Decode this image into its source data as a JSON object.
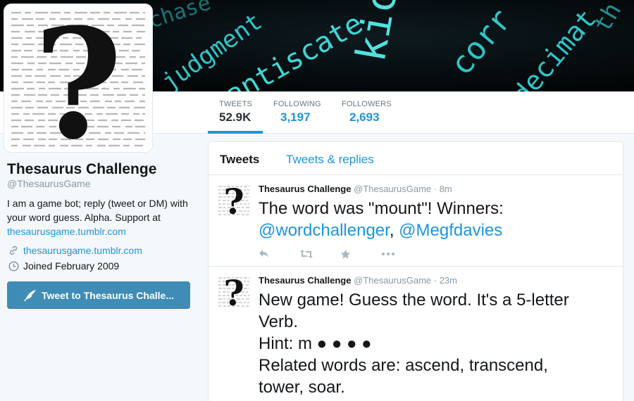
{
  "banner": {
    "words": [
      "judgment",
      "antiscate",
      "kick",
      "corr",
      "decimat",
      "th",
      "chase"
    ]
  },
  "stats": [
    {
      "label": "TWEETS",
      "value": "52.9K"
    },
    {
      "label": "FOLLOWING",
      "value": "3,197"
    },
    {
      "label": "FOLLOWERS",
      "value": "2,693"
    }
  ],
  "profile": {
    "name": "Thesaurus Challenge",
    "handle": "@ThesaurusGame",
    "bio_text": "I am a game bot; reply (tweet or DM) with your word guess. Alpha. Support at",
    "bio_link": "thesaurusgame.tumblr.com",
    "url": "thesaurusgame.tumblr.com",
    "joined": "Joined February 2009",
    "tweet_to_label": "Tweet to Thesaurus Challe..."
  },
  "timeline": {
    "tabs": [
      "Tweets",
      "Tweets & replies"
    ],
    "tweets": [
      {
        "name": "Thesaurus Challenge",
        "handle": "@ThesaurusGame",
        "time": "· 8m",
        "text": "The word was \"mount\"!  Winners:",
        "mention1": "@wordchallenger",
        "sep": ", ",
        "mention2": "@Megfdavies"
      },
      {
        "name": "Thesaurus Challenge",
        "handle": "@ThesaurusGame",
        "time": "· 23m",
        "line1": "New game! Guess the word. It's a 5-letter Verb.",
        "line2": "Hint: m ● ● ● ●",
        "line3": "Related words are: ascend, transcend, tower, soar."
      }
    ]
  },
  "colors": {
    "accent": "#1b95e0",
    "button": "#3f8cb6",
    "banner_text": "#2fc6c9"
  }
}
